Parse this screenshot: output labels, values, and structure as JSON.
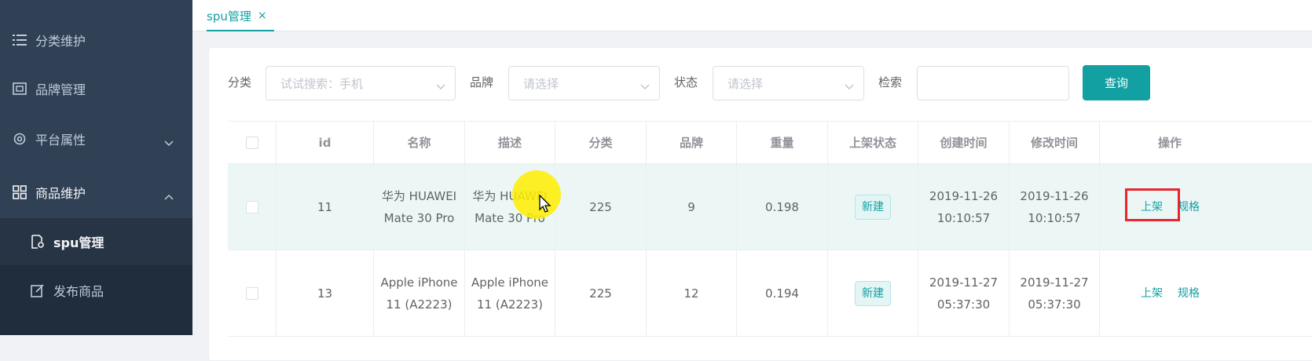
{
  "sidebar": {
    "items": [
      {
        "label": "分类维护",
        "icon": "list-icon"
      },
      {
        "label": "品牌管理",
        "icon": "brand-icon"
      },
      {
        "label": "平台属性",
        "icon": "gear-icon"
      },
      {
        "label": "商品维护",
        "icon": "grid-icon"
      }
    ],
    "subitems": [
      {
        "label": "spu管理",
        "icon": "doc-gear-icon"
      },
      {
        "label": "发布商品",
        "icon": "edit-icon"
      }
    ]
  },
  "tabs": [
    {
      "label": "spu管理",
      "close": "×"
    }
  ],
  "filters": {
    "category_label": "分类",
    "category_placeholder": "试试搜索：手机",
    "brand_label": "品牌",
    "brand_placeholder": "请选择",
    "status_label": "状态",
    "status_placeholder": "请选择",
    "search_label": "检索",
    "query_button": "查询"
  },
  "table": {
    "headers": [
      "id",
      "名称",
      "描述",
      "分类",
      "品牌",
      "重量",
      "上架状态",
      "创建时间",
      "修改时间",
      "操作"
    ],
    "rows": [
      {
        "id": "11",
        "name": "华为 HUAWEI Mate 30 Pro",
        "desc": "华为 HUAWEI Mate 30 Pro",
        "category": "225",
        "brand": "9",
        "weight": "0.198",
        "status": "新建",
        "created_date": "2019-11-26",
        "created_time": "10:10:57",
        "modified_date": "2019-11-26",
        "modified_time": "10:10:57",
        "op1": "上架",
        "op2": "规格"
      },
      {
        "id": "13",
        "name": "Apple iPhone 11 (A2223)",
        "desc": "Apple iPhone 11 (A2223)",
        "category": "225",
        "brand": "12",
        "weight": "0.194",
        "status": "新建",
        "created_date": "2019-11-27",
        "created_time": "05:37:30",
        "modified_date": "2019-11-27",
        "modified_time": "05:37:30",
        "op1": "上架",
        "op2": "规格"
      }
    ]
  },
  "colors": {
    "accent": "#13a0a2",
    "sidebar": "#304156",
    "highlight": "#e8242e"
  }
}
